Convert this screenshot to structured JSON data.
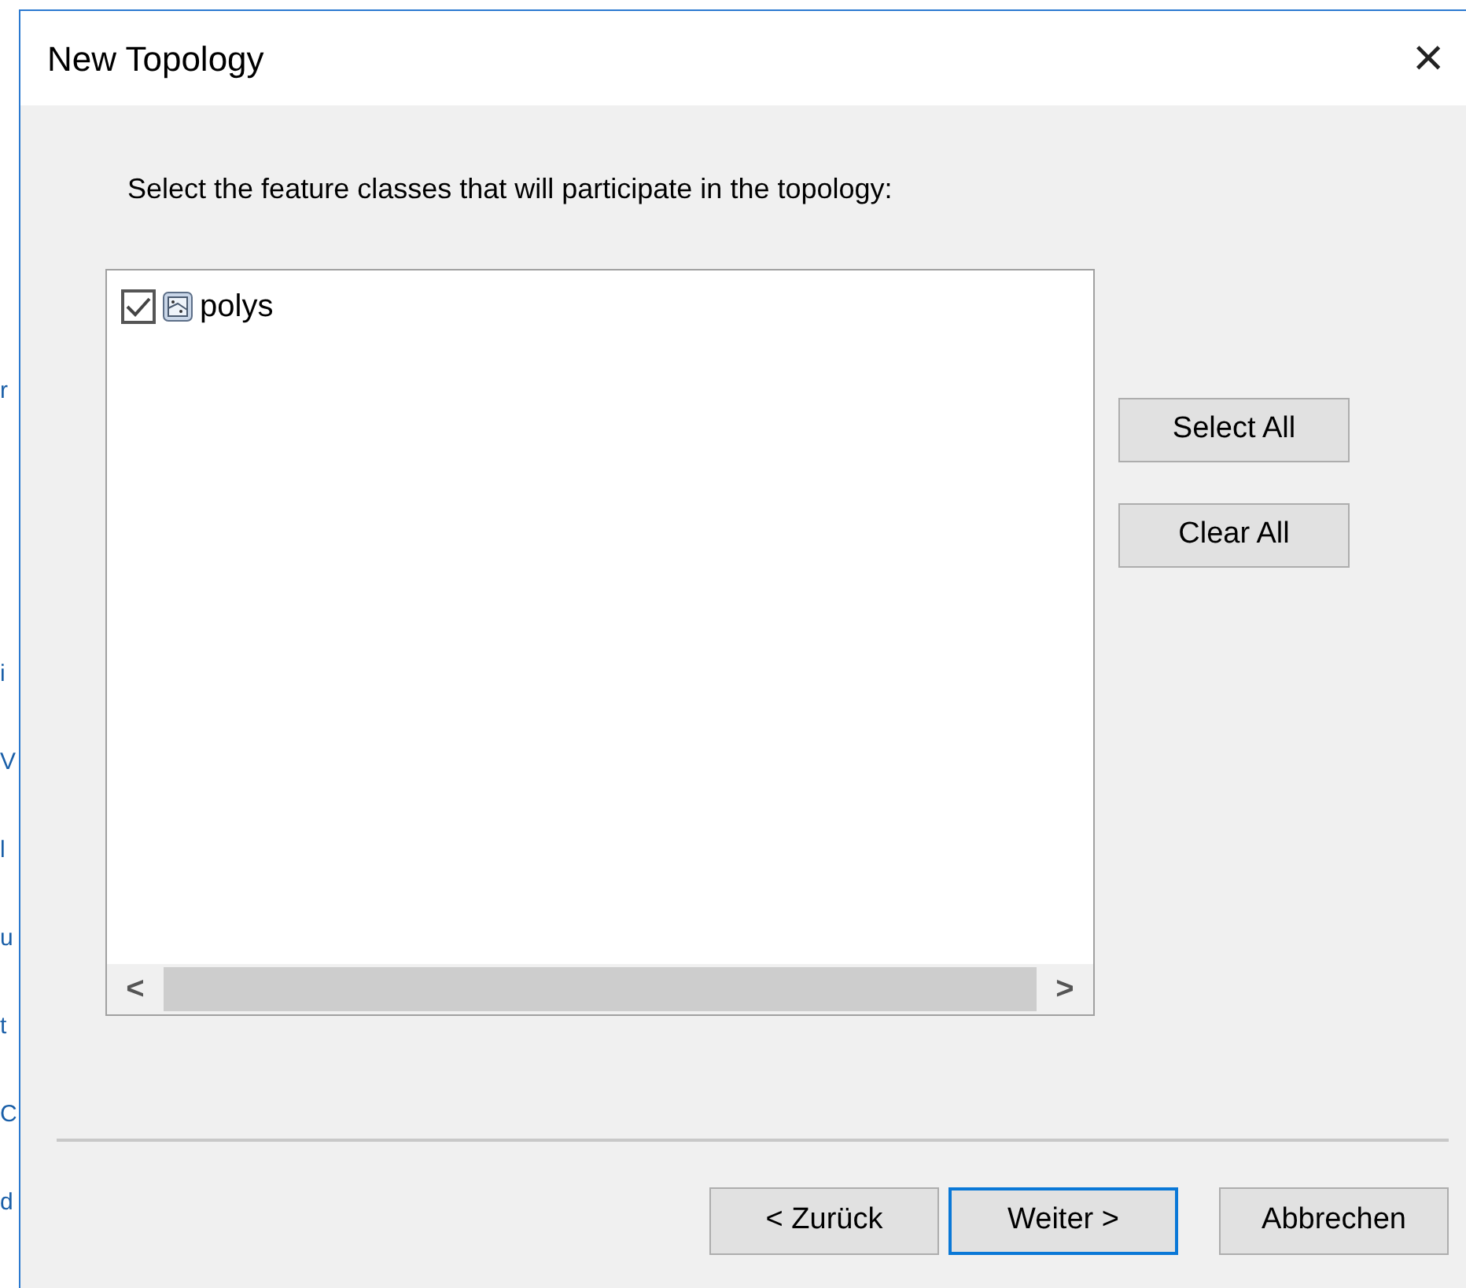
{
  "background_fragments": [
    "r",
    "i",
    "V",
    "l",
    "u",
    "t",
    "C",
    "d"
  ],
  "window": {
    "title": "New Topology",
    "close": "×"
  },
  "instruction": "Select the feature classes that will participate in the topology:",
  "feature_classes": [
    {
      "name": "polys",
      "checked": true
    }
  ],
  "side_buttons": [
    "Select All",
    "Clear All"
  ],
  "scrollbar": {
    "left": "<",
    "right": ">"
  },
  "footer_buttons": [
    {
      "label": "< Zurück",
      "focused": false
    },
    {
      "label": "Weiter >",
      "focused": true
    },
    {
      "label": "Abbrechen",
      "focused": false
    }
  ]
}
